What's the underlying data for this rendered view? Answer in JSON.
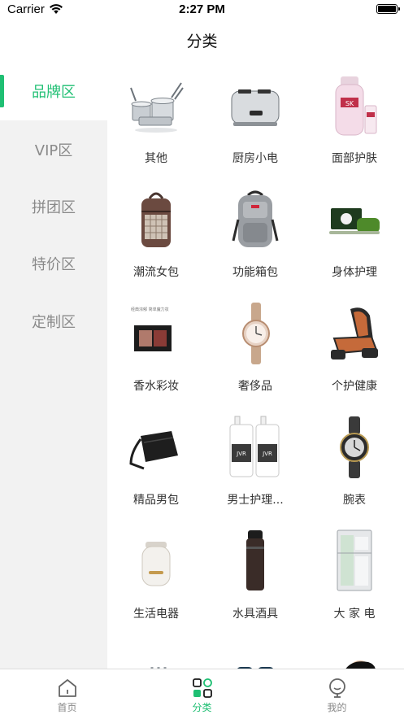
{
  "status": {
    "carrier": "Carrier",
    "time": "2:27 PM"
  },
  "nav": {
    "title": "分类"
  },
  "sidebar": {
    "items": [
      {
        "label": "品牌区",
        "active": true
      },
      {
        "label": "VIP区",
        "active": false
      },
      {
        "label": "拼团区",
        "active": false
      },
      {
        "label": "特价区",
        "active": false
      },
      {
        "label": "定制区",
        "active": false
      }
    ]
  },
  "grid": {
    "items": [
      {
        "label": "其他",
        "icon": "cookware-set-image"
      },
      {
        "label": "厨房小电",
        "icon": "toaster-image"
      },
      {
        "label": "面部护肤",
        "icon": "skincare-bottle-image"
      },
      {
        "label": "潮流女包",
        "icon": "backpack-image"
      },
      {
        "label": "功能箱包",
        "icon": "laptop-backpack-image"
      },
      {
        "label": "身体护理",
        "icon": "soap-bar-image"
      },
      {
        "label": "香水彩妆",
        "icon": "eyeshadow-palette-image"
      },
      {
        "label": "奢侈品",
        "icon": "ladies-watch-image"
      },
      {
        "label": "个护健康",
        "icon": "massage-chair-image"
      },
      {
        "label": "精品男包",
        "icon": "messenger-bag-image"
      },
      {
        "label": "男士护理...",
        "icon": "lotion-bottles-image"
      },
      {
        "label": "腕表",
        "icon": "wristwatch-image"
      },
      {
        "label": "生活电器",
        "icon": "humidifier-image"
      },
      {
        "label": "水具酒具",
        "icon": "water-bottle-image"
      },
      {
        "label": "大 家 电",
        "icon": "refrigerator-image"
      },
      {
        "label": "",
        "icon": "cutlery-image"
      },
      {
        "label": "",
        "icon": "sunglasses-image"
      },
      {
        "label": "",
        "icon": "portrait-image"
      }
    ]
  },
  "tabbar": {
    "items": [
      {
        "label": "首页",
        "icon": "home-icon",
        "active": false
      },
      {
        "label": "分类",
        "icon": "category-grid-icon",
        "active": true
      },
      {
        "label": "我的",
        "icon": "profile-icon",
        "active": false
      }
    ]
  },
  "colors": {
    "accent": "#1fbf73",
    "sidebar_bg": "#f2f2f2",
    "inactive_text": "#8a8a8a"
  }
}
